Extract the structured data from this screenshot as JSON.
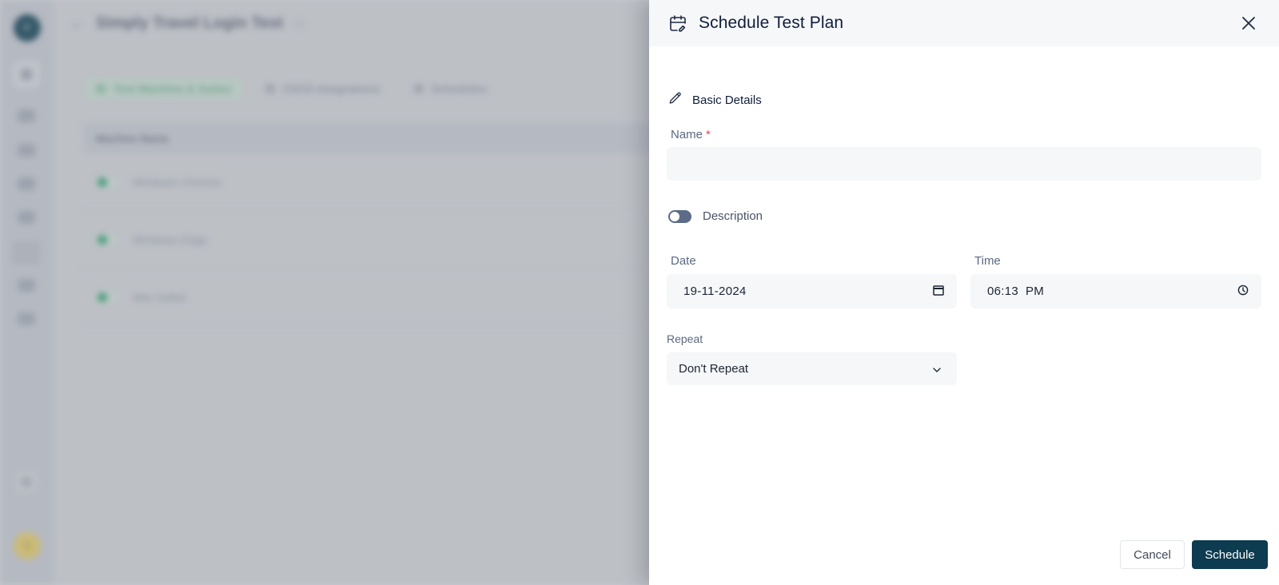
{
  "background": {
    "sidebar": {
      "logo_initial": "P",
      "avatar_initial": "S",
      "items": [
        "home",
        "dashboard",
        "analytics",
        "test-cases",
        "reports",
        "test-plans",
        "settings",
        "integrations"
      ]
    },
    "page_title": "Simply Travel Login Test",
    "tabs": [
      {
        "label": "Test Machine & Suites",
        "active": true
      },
      {
        "label": "CI/CD Integrations",
        "active": false
      },
      {
        "label": "Schedules",
        "active": false
      }
    ],
    "table": {
      "column_header": "Machine Name",
      "rows": [
        {
          "name": "Windows Chrome",
          "enabled": true
        },
        {
          "name": "Windows Edge",
          "enabled": true
        },
        {
          "name": "Mac Safari",
          "enabled": true
        }
      ]
    }
  },
  "drawer": {
    "title": "Schedule Test Plan",
    "section_title": "Basic Details",
    "name": {
      "label": "Name",
      "required_mark": "*",
      "value": "",
      "placeholder": ""
    },
    "description": {
      "label": "Description",
      "enabled": false
    },
    "date": {
      "label": "Date",
      "value": "19-11-2024"
    },
    "time": {
      "label": "Time",
      "value": "06:13  PM"
    },
    "repeat": {
      "label": "Repeat",
      "selected": "Don't Repeat"
    },
    "buttons": {
      "cancel": "Cancel",
      "schedule": "Schedule"
    }
  },
  "colors": {
    "primary": "#0d3b4f",
    "required": "#e5484d",
    "toggle_off": "#5b6b88",
    "field_bg": "#f5f7f9",
    "success": "#3d9e78"
  }
}
